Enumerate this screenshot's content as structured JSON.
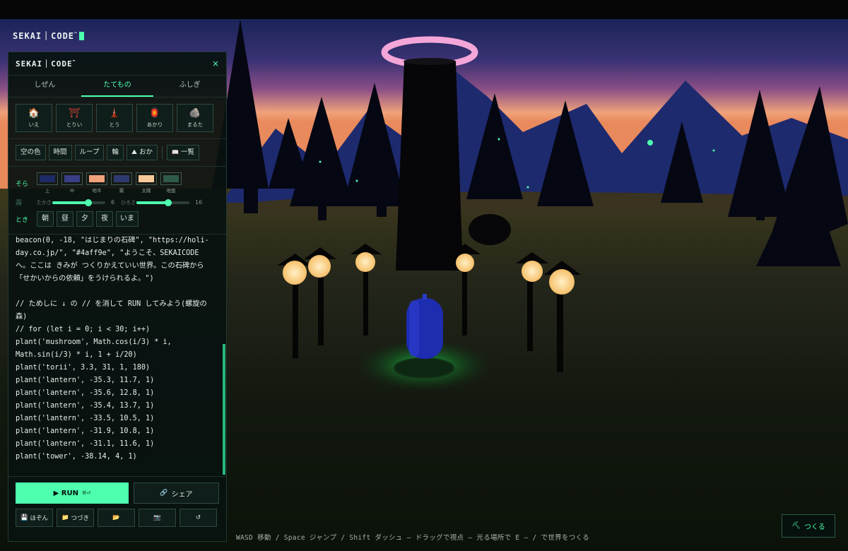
{
  "brand": "SEKAI｜CODE",
  "brand_mark": "™",
  "panel": {
    "title": "SEKAI｜CODE",
    "title_mark": "™",
    "close_label": "×",
    "tabs": [
      {
        "label": "しぜん",
        "active": false
      },
      {
        "label": "たてもの",
        "active": true
      },
      {
        "label": "ふしぎ",
        "active": false
      }
    ],
    "palette": [
      {
        "name": "house",
        "label": "いえ",
        "icon": "🏠"
      },
      {
        "name": "torii",
        "label": "とりい",
        "icon": "⛩"
      },
      {
        "name": "tower",
        "label": "とう",
        "icon": "🗼"
      },
      {
        "name": "lantern",
        "label": "あかり",
        "icon": "🏮"
      },
      {
        "name": "rock",
        "label": "まるた",
        "icon": "🪨"
      }
    ],
    "toolbar": {
      "sky_color": "空の色",
      "time": "時間",
      "loop": "ループ",
      "ring": "輪",
      "hill_icon": "⛰",
      "hill": "おか",
      "list_icon": "📖",
      "list": "一覧"
    },
    "settings": {
      "sky_label": "そら",
      "sky_swatches": [
        {
          "name": "top",
          "label": "上",
          "color": "#1c2a66"
        },
        {
          "name": "middle",
          "label": "中",
          "color": "#3a3e86"
        },
        {
          "name": "horizon",
          "label": "地平",
          "color": "#f0a27a"
        },
        {
          "name": "fog",
          "label": "霧",
          "color": "#2e3a6e"
        },
        {
          "name": "sun",
          "label": "太陽",
          "color": "#f6c89a"
        },
        {
          "name": "ground",
          "label": "地面",
          "color": "#2e5a4a"
        }
      ],
      "fog_label": "霧",
      "fog": {
        "near_label": "たかさ",
        "near_value": 6,
        "near_fraction": 0.68,
        "far_label": "ひろさ",
        "far_value": 16,
        "far_fraction": 0.6
      },
      "time_label": "とき",
      "times": [
        "朝",
        "昼",
        "夕",
        "夜",
        "いま"
      ]
    },
    "code_lines": [
      "beacon(0, -18, \"はじまりの石碑\", \"https://holi-",
      "day.co.jp/\", \"#4aff9e\", \"ようこそ、SEKAICODE",
      "へ。ここは きみが つくりかえていい世界。この石碑から",
      "「せかいからの依頼」をうけられるよ。\")",
      "",
      "// ためしに ↓ の // を消して RUN してみよう(螺旋の",
      "森)",
      "// for (let i = 0; i < 30; i++)",
      "plant('mushroom', Math.cos(i/3) * i,",
      "Math.sin(i/3) * i, 1 + i/20)",
      "plant('torii', 3.3, 31, 1, 180)",
      "plant('lantern', -35.3, 11.7, 1)",
      "plant('lantern', -35.6, 12.8, 1)",
      "plant('lantern', -35.4, 13.7, 1)",
      "plant('lantern', -33.5, 10.5, 1)",
      "plant('lantern', -31.9, 10.8, 1)",
      "plant('lantern', -31.1, 11.6, 1)",
      "plant('tower', -38.14, 4, 1)"
    ],
    "actions": {
      "run_label": "▶ RUN",
      "run_shortcut": "⌘⏎",
      "share_icon": "🔗",
      "share_label": "シェア",
      "save_icon": "💾",
      "save_label": "ほぞん",
      "continue_icon": "📁",
      "continue_label": "つづき",
      "open_icon": "📂",
      "camera_icon": "📷",
      "reset_icon": "↺"
    }
  },
  "hint": "WASD 移動 / Space ジャンプ / Shift ダッシュ — ドラッグで視点 — 光る場所で E — / で世界をつくる",
  "make_button": {
    "icon": "⛏",
    "label": "つくる"
  },
  "colors": {
    "accent": "#4dffae",
    "panel_bg": "#08120f",
    "sky_top": "#1c2a66",
    "sky_horizon": "#f0a27a"
  }
}
